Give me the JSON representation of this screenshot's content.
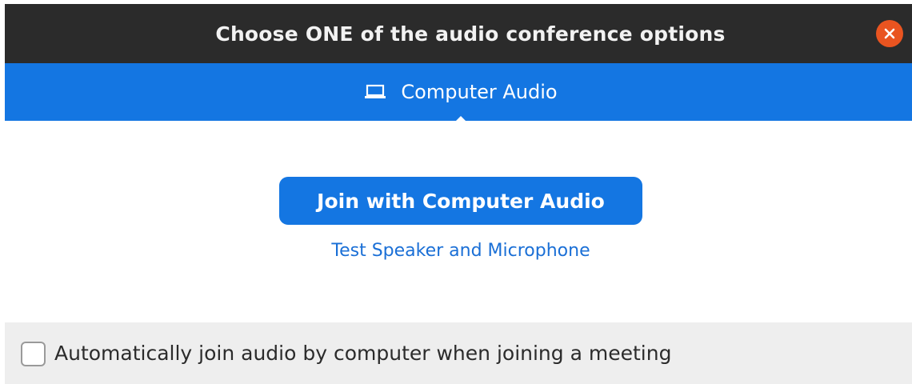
{
  "window": {
    "title": "Choose ONE of the audio conference options",
    "close_icon": "close-icon"
  },
  "tabs": [
    {
      "label": "Computer Audio",
      "icon": "laptop-icon",
      "selected": true
    }
  ],
  "main": {
    "join_button_label": "Join with Computer Audio",
    "test_link_label": "Test Speaker and Microphone"
  },
  "footer": {
    "auto_join_label": "Automatically join audio by computer when joining a meeting",
    "auto_join_checked": false
  },
  "colors": {
    "titlebar": "#2b2b2b",
    "accent": "#1476e2",
    "close": "#e95420",
    "link": "#1a6fd6",
    "footer": "#eeeeee"
  }
}
